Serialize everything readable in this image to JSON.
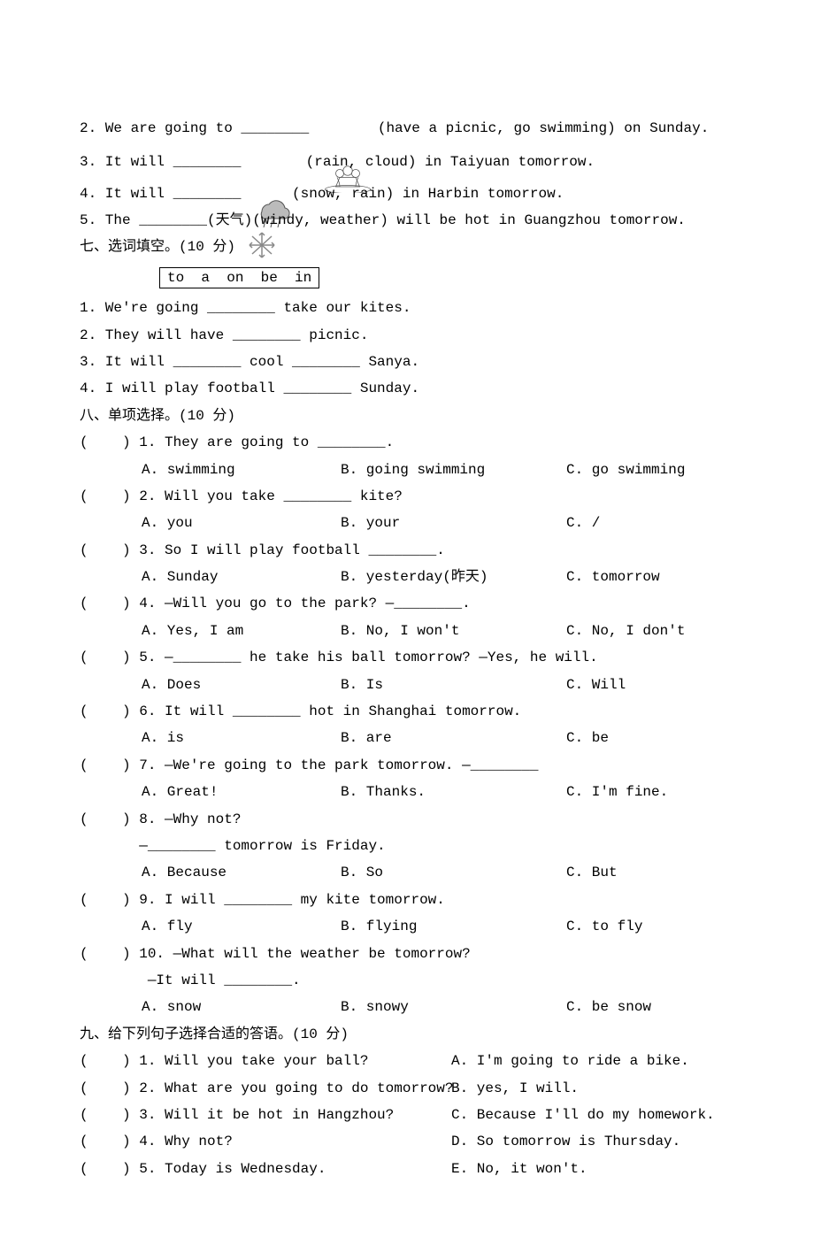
{
  "q2": {
    "prefix": "2. We are going to ________ ",
    "suffix": "(have a picnic, go swimming) on Sunday."
  },
  "q3": {
    "prefix": "3. It will ________ ",
    "suffix": " (rain, cloud) in Taiyuan tomorrow."
  },
  "q4": {
    "prefix": "4. It will ________",
    "suffix": " (snow, rain) in Harbin tomorrow."
  },
  "q5": "5. The ________(天气)(windy, weather) will be hot in Guangzhou tomorrow.",
  "sec7": {
    "heading": "七、选词填空。(10 分)",
    "box": "to  a  on  be  in",
    "items": [
      "1. We're going ________ take our kites.",
      "2. They will have ________ picnic.",
      "3. It will ________ cool ________ Sanya.",
      "4. I will play football ________ Sunday."
    ]
  },
  "sec8": {
    "heading": "八、单项选择。(10 分)",
    "items": [
      {
        "q": "(    ) 1. They are going to ________.",
        "a": "A. swimming",
        "b": "B. going swimming",
        "c": "C. go swimming"
      },
      {
        "q": "(    ) 2. Will you take ________ kite?",
        "a": "A. you",
        "b": "B. your",
        "c": "C. /"
      },
      {
        "q": "(    ) 3. So I will play football ________.",
        "a": "A. Sunday",
        "b": "B. yesterday(昨天)",
        "c": "C. tomorrow"
      },
      {
        "q": "(    ) 4. —Will you go to the park? —________.",
        "a": "A. Yes, I am",
        "b": "B. No, I won't",
        "c": "C. No, I don't"
      },
      {
        "q": "(    ) 5. —________ he take his ball tomorrow? —Yes, he will.",
        "a": "A. Does",
        "b": "B. Is",
        "c": "C. Will"
      },
      {
        "q": "(    ) 6. It will ________ hot in Shanghai tomorrow.",
        "a": "A. is",
        "b": "B. are",
        "c": "C. be"
      },
      {
        "q": "(    ) 7. —We're going to the park tomorrow. —________",
        "a": "A. Great!",
        "b": "B. Thanks.",
        "c": "C. I'm fine."
      },
      {
        "q": "(    ) 8. —Why not?",
        "q2": "       —________ tomorrow is Friday.",
        "a": "A. Because",
        "b": "B. So",
        "c": "C. But"
      },
      {
        "q": "(    ) 9. I will ________ my kite tomorrow.",
        "a": "A. fly",
        "b": "B. flying",
        "c": "C. to fly"
      },
      {
        "q": "(    ) 10. —What will the weather be tomorrow?",
        "q2": "        —It will ________.",
        "a": "A. snow",
        "b": "B. snowy",
        "c": "C. be snow"
      }
    ]
  },
  "sec9": {
    "heading": "九、给下列句子选择合适的答语。(10 分)",
    "rows": [
      {
        "q": "(    ) 1. Will you take your ball?",
        "a": "A. I'm going to ride a bike."
      },
      {
        "q": "(    ) 2. What are you going to do tomorrow?",
        "a": "B. yes, I will."
      },
      {
        "q": "(    ) 3. Will it be hot in Hangzhou?",
        "a": "C. Because I'll do my homework."
      },
      {
        "q": "(    ) 4. Why not?",
        "a": "D. So tomorrow is Thursday."
      },
      {
        "q": "(    ) 5. Today is Wednesday.",
        "a": "E. No, it won't."
      }
    ]
  }
}
